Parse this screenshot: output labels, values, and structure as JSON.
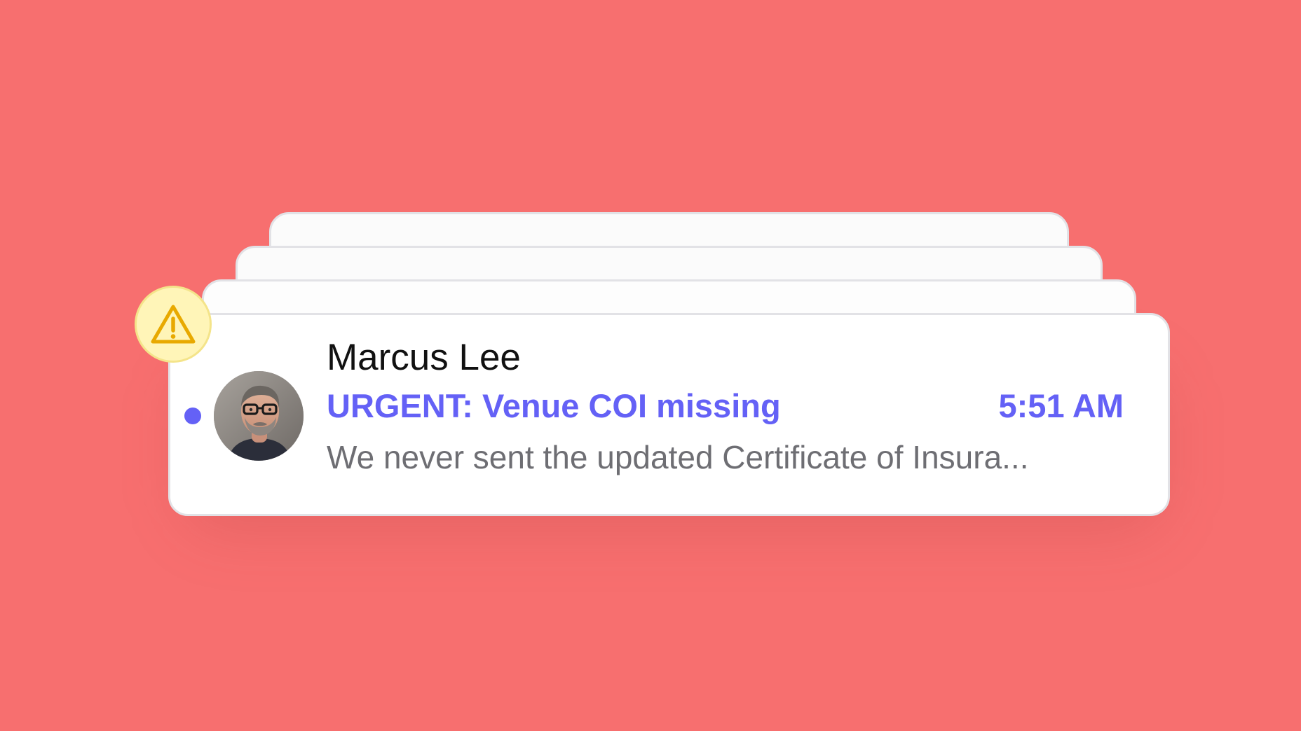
{
  "background_color": "#f76f6f",
  "accent_color": "#6461f6",
  "warning": {
    "icon": "warning-triangle-icon",
    "color": "#e8a900",
    "badge_color": "#fff5b8"
  },
  "email": {
    "unread": true,
    "avatar": "person-avatar",
    "sender": "Marcus Lee",
    "subject": "URGENT: Venue COI missing",
    "time": "5:51 AM",
    "preview": "We never sent the updated Certificate of Insura..."
  },
  "stacked_cards_behind": 3
}
